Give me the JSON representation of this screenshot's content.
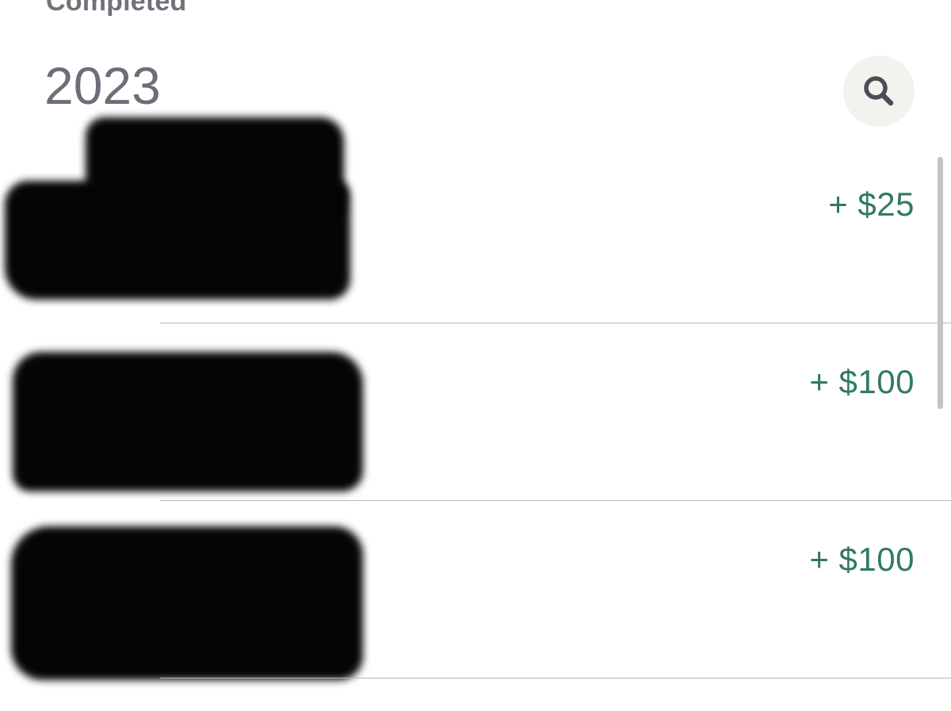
{
  "header": {
    "section_label": "Completed",
    "year": "2023"
  },
  "search": {
    "icon": "search-icon",
    "icon_color": "#4a4d55",
    "button_bg": "#f3f2ee"
  },
  "transactions": [
    {
      "amount": "+ $25",
      "details_redacted": true
    },
    {
      "amount": "+ $100",
      "details_redacted": true
    },
    {
      "amount": "+ $100",
      "details_redacted": true
    }
  ],
  "colors": {
    "amount_positive": "#2f7a63",
    "heading_text": "#6b6f78",
    "divider": "#b9b9b9"
  }
}
